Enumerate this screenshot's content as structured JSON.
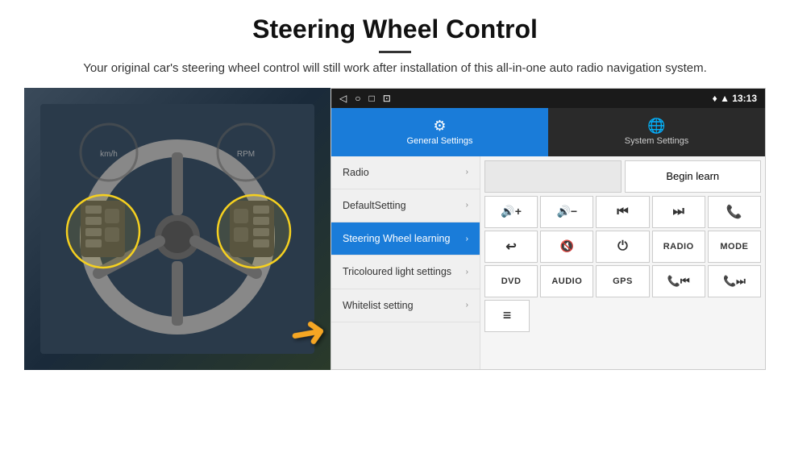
{
  "header": {
    "title": "Steering Wheel Control",
    "description": "Your original car's steering wheel control will still work after installation of this all-in-one auto radio navigation system."
  },
  "status_bar": {
    "icons": [
      "◁",
      "○",
      "□",
      "⊡"
    ],
    "time": "13:13",
    "signal_icons": [
      "♦",
      "▲"
    ]
  },
  "tabs": [
    {
      "id": "general",
      "label": "General Settings",
      "active": true
    },
    {
      "id": "system",
      "label": "System Settings",
      "active": false
    }
  ],
  "menu_items": [
    {
      "label": "Radio",
      "active": false
    },
    {
      "label": "DefaultSetting",
      "active": false
    },
    {
      "label": "Steering Wheel learning",
      "active": true
    },
    {
      "label": "Tricoloured light settings",
      "active": false
    },
    {
      "label": "Whitelist setting",
      "active": false
    }
  ],
  "controls": {
    "begin_learn_label": "Begin learn",
    "row1": [
      "🔊+",
      "🔊−",
      "⏮",
      "⏭",
      "📞"
    ],
    "row2": [
      "↩",
      "🔊×",
      "⏻",
      "RADIO",
      "MODE"
    ],
    "row3": [
      "DVD",
      "AUDIO",
      "GPS",
      "📞⏮",
      "📞⏭"
    ],
    "bottom_icon": "≡"
  }
}
